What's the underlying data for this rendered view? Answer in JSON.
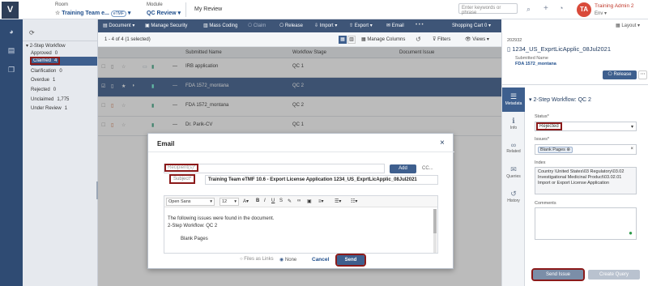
{
  "topbar": {
    "room_label": "Room",
    "room_value": "Training Team e...",
    "room_tag": "eTMF",
    "module_label": "Module",
    "module_value": "QC Review",
    "crumb": "My Review",
    "search_placeholder": "Enter keywords or phrase",
    "user_initials": "TA",
    "user_name": "Training Admin 2",
    "env": "Env"
  },
  "nav": {
    "refresh": "C",
    "root": "2-Step Workflow",
    "items": [
      {
        "label": "Approved",
        "count": "0"
      },
      {
        "label": "Claimed",
        "count": "4"
      },
      {
        "label": "Clarification",
        "count": "0"
      },
      {
        "label": "Overdue",
        "count": "1"
      },
      {
        "label": "Rejected",
        "count": "0"
      },
      {
        "label": "Unclaimed",
        "count": "1,775"
      },
      {
        "label": "Under Review",
        "count": "1"
      }
    ]
  },
  "toolbar": {
    "document": "Document",
    "manage_security": "Manage Security",
    "mass_coding": "Mass Coding",
    "claim": "Claim",
    "release": "Release",
    "import": "Import",
    "export": "Export",
    "email": "Email",
    "shopping_cart": "Shopping Cart 0",
    "layout": "Layout"
  },
  "subbar": {
    "count_text": "1 - 4 of 4 (1 selected)",
    "manage_columns": "Manage Columns",
    "filters": "Filters",
    "views": "Views"
  },
  "grid": {
    "headers": [
      "Submitted Name",
      "Workflow Stage",
      "Document Issue"
    ],
    "rows": [
      {
        "name": "IRB application",
        "stage": "QC 1"
      },
      {
        "name": "FDA 1572_montana",
        "stage": "QC 2"
      },
      {
        "name": "FDA 1572_montana",
        "stage": "QC 2"
      },
      {
        "name": "Dr. Parik-CV",
        "stage": "QC 1"
      }
    ]
  },
  "right": {
    "doc_id": "202932",
    "doc_title": "1234_US_ExprtLicApplic_08Jul2021",
    "sub_label": "Submitted Name",
    "sub_value": "FDA 1572_montana",
    "release": "Release",
    "workflow": "2-Step Workflow: QC 2",
    "status_label": "Status*",
    "status_value": "Rejected",
    "issues_label": "Issues*",
    "issue_chip": "Blank Pages",
    "index_label": "Index",
    "index_value": "Country \\United States\\03 Regulatory\\03.02 Investigational Medicinal Product\\03.02.01 Import or Export License Application",
    "comments_label": "Comments",
    "send_issue": "Send Issue",
    "create_query": "Create Query",
    "tabs": [
      {
        "label": "Metadata",
        "icon": "☰"
      },
      {
        "label": "Info",
        "icon": "ℹ"
      },
      {
        "label": "Related",
        "icon": "∞"
      },
      {
        "label": "Queries",
        "icon": "✉"
      },
      {
        "label": "History",
        "icon": "↺"
      }
    ]
  },
  "email": {
    "title": "Email",
    "close": "×",
    "recipients_placeholder": "Recipient(s)*",
    "add": "Add",
    "cc": "CC...",
    "subject_label": "Subject*",
    "subject_value": "Training Team eTMF 10.6 - Export License Application 1234_US_ExprtLicApplic_08Jul2021",
    "font": "Open Sans",
    "size": "12",
    "body_line1": "The following issues were found in the document.",
    "body_line2": "2-Step Workflow: QC 2",
    "body_line3": "Blank Pages",
    "files_as_links": "Files as Links",
    "none": "None",
    "cancel": "Cancel",
    "send": "Send"
  }
}
